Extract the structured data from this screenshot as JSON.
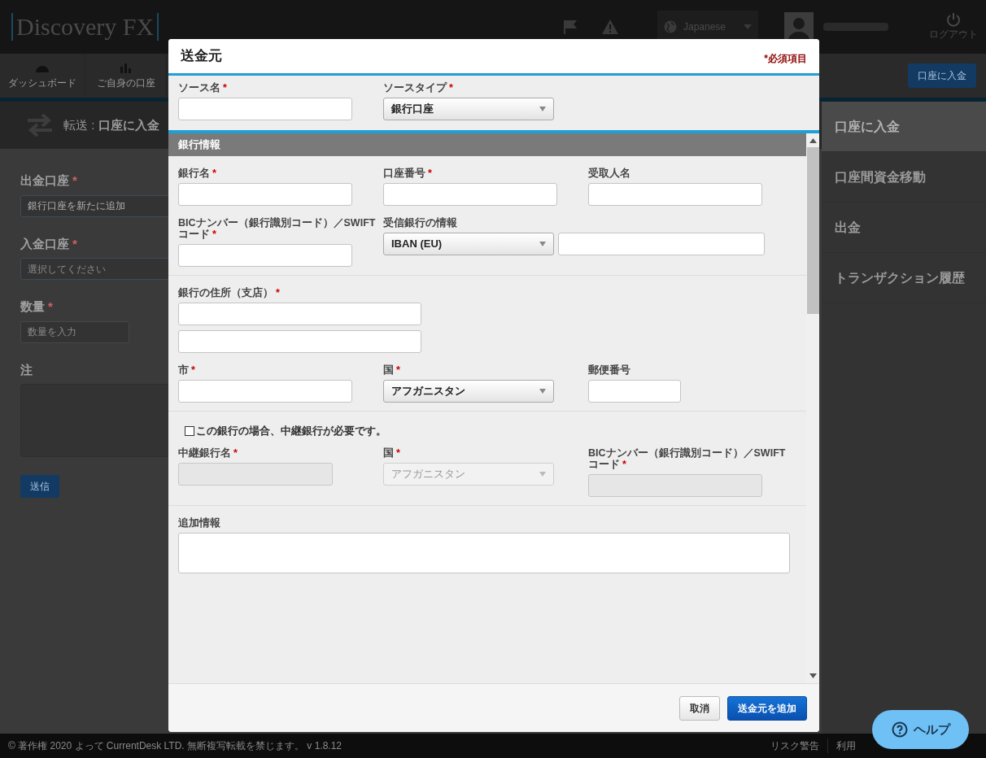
{
  "app": {
    "logo": "Discovery FX",
    "language": "Japanese",
    "logout": "ログアウト"
  },
  "nav": {
    "items": [
      "ダッシュボード",
      "ご自身の口座"
    ],
    "deposit_button": "口座に入金"
  },
  "page": {
    "title": "転送 : **口座に入金**",
    "fields": [
      {
        "label": "出金口座",
        "mark": "*",
        "kind": "select",
        "value": "銀行口座を新たに追加"
      },
      {
        "label": "入金口座",
        "mark": "*",
        "kind": "select",
        "placeholder": "選択してください"
      },
      {
        "label": "数量",
        "mark": "*",
        "kind": "input",
        "placeholder": "数量を入力"
      },
      {
        "label": "注",
        "kind": "textarea"
      }
    ],
    "submit": "送信"
  },
  "side_menu": [
    {
      "label": "口座に入金",
      "selected": true
    },
    {
      "label": "口座間資金移動",
      "selected": false
    },
    {
      "label": "出金",
      "selected": false
    },
    {
      "label": "トランザクション履歴",
      "selected": false
    }
  ],
  "modal": {
    "title": "送金元",
    "required_note": "*必須項目",
    "top": [
      {
        "label": "ソース名",
        "mark": "*",
        "kind": "input"
      },
      {
        "label": "ソースタイプ",
        "mark": "*",
        "kind": "select",
        "value": "銀行口座"
      }
    ],
    "section_title": "銀行情報",
    "groups": [
      {
        "rows": [
          [
            {
              "label": "銀行名",
              "mark": "*",
              "kind": "input"
            },
            {
              "label": "口座番号",
              "mark": "*",
              "kind": "input"
            },
            {
              "label": "受取人名",
              "kind": "input"
            }
          ],
          [
            {
              "label": "BICナンバー（銀行識別コード）／SWIFTコード",
              "mark": "*",
              "kind": "input"
            },
            {
              "label": "受信銀行の情報",
              "kind": "select_input",
              "value": "IBAN (EU)"
            }
          ]
        ]
      },
      {
        "rows": [
          [
            {
              "label": "銀行の住所（支店）",
              "mark": "*",
              "kind": "address"
            }
          ],
          [
            {
              "label": "市",
              "mark": "*",
              "kind": "input"
            },
            {
              "label": "国",
              "mark": "*",
              "kind": "select",
              "value": "アフガニスタン"
            },
            {
              "label": "郵便番号",
              "kind": "short_input"
            }
          ]
        ]
      },
      {
        "checkbox": {
          "label": "この銀行の場合、中継銀行が必要です。",
          "checked": false
        },
        "rows": [
          [
            {
              "label": "中継銀行名",
              "mark": "*",
              "kind": "input",
              "disabled": true
            },
            {
              "label": "国",
              "mark": "*",
              "kind": "select",
              "value": "アフガニスタン",
              "disabled": true
            },
            {
              "label": "BICナンバー（銀行識別コード）／SWIFTコード",
              "mark": "*",
              "kind": "input",
              "disabled": true
            }
          ]
        ]
      },
      {
        "rows": [
          [
            {
              "label": "追加情報",
              "kind": "textarea"
            }
          ]
        ]
      }
    ],
    "buttons": [
      {
        "label": "取消",
        "kind": "secondary"
      },
      {
        "label": "送金元を追加",
        "kind": "primary"
      }
    ]
  },
  "footer": {
    "copyright": "© 著作権 2020 よって CurrentDesk LTD. 無断複写転載を禁じます。 v 1.8.12",
    "links": [
      "リスク警告",
      "利用"
    ]
  },
  "help_button": "ヘルプ"
}
